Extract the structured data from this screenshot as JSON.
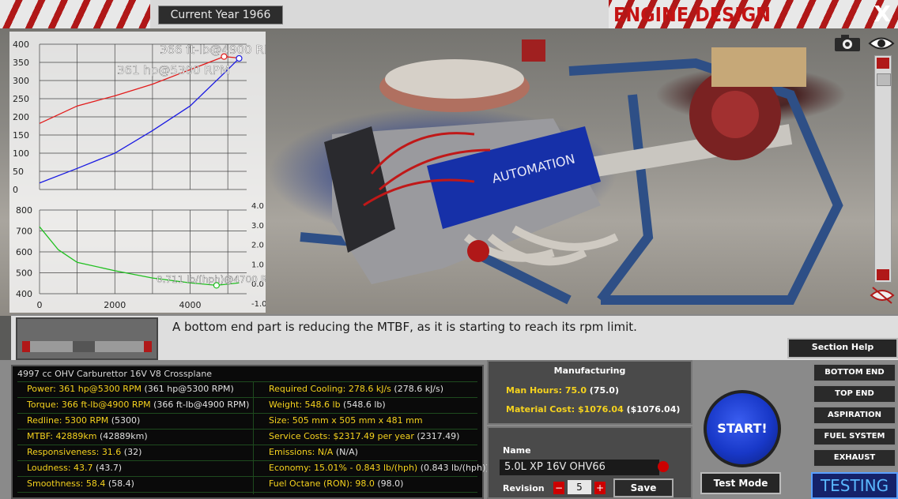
{
  "header": {
    "year_label": "Current Year 1966",
    "title": "ENGINE DESIGN",
    "close_label": "X"
  },
  "graph": {
    "power_label": "361 hp@5300 RPM",
    "torque_label": "366 ft-lb@4900 RPM",
    "economy_label": "0.711 lb/(hph)@4700 RPM",
    "top_y_ticks": [
      "400",
      "350",
      "300",
      "250",
      "200",
      "150",
      "100",
      "50",
      "0"
    ],
    "bottom_y_ticks": [
      "800",
      "700",
      "600",
      "500",
      "400"
    ],
    "right_y_ticks": [
      "4.0",
      "3.0",
      "2.0",
      "1.0",
      "0.0",
      "-1.0"
    ],
    "x_ticks": [
      "0",
      "2000",
      "4000"
    ]
  },
  "chart_data": [
    {
      "type": "line",
      "series": [
        {
          "color": "#e21b1b",
          "x": [
            0,
            1000,
            2000,
            3000,
            4000,
            4900,
            5300
          ],
          "y": [
            182,
            230,
            258,
            290,
            330,
            366,
            362
          ]
        },
        {
          "color": "#1b1be2",
          "x": [
            0,
            1000,
            2000,
            3000,
            4000,
            4900,
            5300
          ],
          "y": [
            18,
            58,
            100,
            162,
            230,
            320,
            361
          ]
        }
      ],
      "ylim": [
        0,
        400
      ],
      "xlim": [
        0,
        5500
      ]
    },
    {
      "type": "line",
      "series": [
        {
          "color": "#20c020",
          "x": [
            0,
            500,
            1000,
            2000,
            3000,
            4000,
            4700,
            5300
          ],
          "y": [
            720,
            610,
            550,
            510,
            475,
            452,
            440,
            452
          ]
        }
      ],
      "ylim": [
        400,
        800
      ],
      "xlim": [
        0,
        5500
      ]
    }
  ],
  "message": "A bottom end part is reducing the MTBF, as it is starting to reach its rpm limit.",
  "section_help": "Section Help",
  "stats": {
    "header": "4997 cc OHV Carburettor 16V V8 Crossplane",
    "rows": [
      [
        {
          "label": "Power: ",
          "value": "361 hp@5300 RPM",
          "paren": " (361 hp@5300 RPM)"
        },
        {
          "label": "Required Cooling: ",
          "value": "278.6 kJ/s",
          "paren": " (278.6 kJ/s)"
        }
      ],
      [
        {
          "label": "Torque: ",
          "value": "366 ft-lb@4900 RPM",
          "paren": " (366 ft-lb@4900 RPM)"
        },
        {
          "label": "Weight: ",
          "value": "548.6 lb",
          "paren": " (548.6 lb)"
        }
      ],
      [
        {
          "label": "Redline: ",
          "value": "5300 RPM",
          "paren": " (5300)"
        },
        {
          "label": "Size: ",
          "value": "505 mm x 505 mm x 481 mm",
          "paren": ""
        }
      ],
      [
        {
          "label": "MTBF: ",
          "value": "42889km",
          "paren": " (42889km)"
        },
        {
          "label": "Service Costs: ",
          "value": "$2317.49 per year",
          "paren": " (2317.49)"
        }
      ],
      [
        {
          "label": "Responsiveness: ",
          "value": "31.6",
          "paren": " (32)"
        },
        {
          "label": "Emissions: ",
          "value": "N/A",
          "paren": " (N/A)"
        }
      ],
      [
        {
          "label": "Loudness: ",
          "value": "43.7",
          "paren": " (43.7)"
        },
        {
          "label": "Economy: ",
          "value": "15.01% - 0.843 lb/(hph)",
          "paren": " (0.843 lb/(hph))"
        }
      ],
      [
        {
          "label": "Smoothness: ",
          "value": "58.4",
          "paren": " (58.4)"
        },
        {
          "label": "Fuel Octane (RON): ",
          "value": "98.0",
          "paren": " (98.0)"
        }
      ]
    ]
  },
  "manufacturing": {
    "title": "Manufacturing",
    "man_hours_label": "Man Hours: ",
    "man_hours_value": "75.0",
    "man_hours_paren": " (75.0)",
    "material_label": "Material Cost: ",
    "material_value": "$1076.04",
    "material_paren": " ($1076.04)"
  },
  "name_panel": {
    "name_label": "Name",
    "name_value": "5.0L XP 16V OHV66",
    "revision_label": "Revision",
    "revision_value": "5",
    "minus": "−",
    "plus": "+",
    "save": "Save"
  },
  "start_label": "START!",
  "test_mode_label": "Test Mode",
  "side_buttons": [
    "BOTTOM END",
    "TOP END",
    "ASPIRATION",
    "FUEL SYSTEM",
    "EXHAUST"
  ],
  "testing_label": "TESTING"
}
